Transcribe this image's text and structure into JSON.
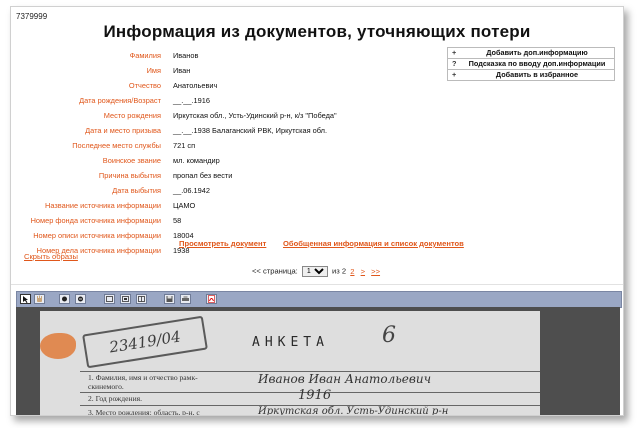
{
  "record_id": "7379999",
  "title": "Информация из документов, уточняющих потери",
  "fields": [
    {
      "label": "Фамилия",
      "value": "Иванов"
    },
    {
      "label": "Имя",
      "value": "Иван"
    },
    {
      "label": "Отчество",
      "value": "Анатольевич"
    },
    {
      "label": "Дата рождения/Возраст",
      "value": "__.__.1916"
    },
    {
      "label": "Место рождения",
      "value": "Иркутская обл., Усть-Удинский р-н, к/з \"Победа\""
    },
    {
      "label": "Дата и место призыва",
      "value": "__.__.1938 Балаганский РВК, Иркутская обл."
    },
    {
      "label": "Последнее место службы",
      "value": "721 сп"
    },
    {
      "label": "Воинское звание",
      "value": "мл. командир"
    },
    {
      "label": "Причина выбытия",
      "value": "пропал без вести"
    },
    {
      "label": "Дата выбытия",
      "value": "__.06.1942"
    },
    {
      "label": "Название источника информации",
      "value": "ЦАМО"
    },
    {
      "label": "Номер фонда источника информации",
      "value": "58"
    },
    {
      "label": "Номер описи источника информации",
      "value": "18004"
    },
    {
      "label": "Номер дела источника информации",
      "value": "1938"
    }
  ],
  "actions": [
    {
      "icon": "+",
      "label": "Добавить доп.информацию"
    },
    {
      "icon": "?",
      "label": "Подсказка по вводу доп.информации"
    },
    {
      "icon": "+",
      "label": "Добавить в избранное"
    }
  ],
  "links": {
    "view_document": "Просмотреть документ",
    "summary": "Обобщенная информация и список документов",
    "hide_images": "Скрыть образы"
  },
  "pager": {
    "prev": "<<",
    "page_label": "страница:",
    "current": "1",
    "of_label": "из 2",
    "next_page": "2",
    "next": ">",
    "last": ">>"
  },
  "document": {
    "heading": "АНКЕТА",
    "stamp": "23419/04",
    "sheet_mark": "6",
    "row1": "1. Фамилия, имя и отчество рамк-",
    "row1b": "скинемого.",
    "row2": "2. Год рождения.",
    "row3": "3. Место рождения: область, р-н, с",
    "hand_name": "Иванов  Иван  Анатольевич",
    "hand_year": "1916",
    "hand_place": "Иркутская  обл.  Усть-Удинский  р-н"
  },
  "colors": {
    "label": "#e0571b",
    "link": "#e0571b",
    "toolbar": "#9aa7c4",
    "viewer_bg": "#4e4e4e"
  },
  "toolbar_icons": [
    "pointer-icon",
    "hand-icon",
    "zoom-in-icon",
    "zoom-out-icon",
    "fit-width-icon",
    "fit-page-icon",
    "actual-size-icon",
    "save-icon",
    "print-icon",
    "pdf-icon"
  ]
}
